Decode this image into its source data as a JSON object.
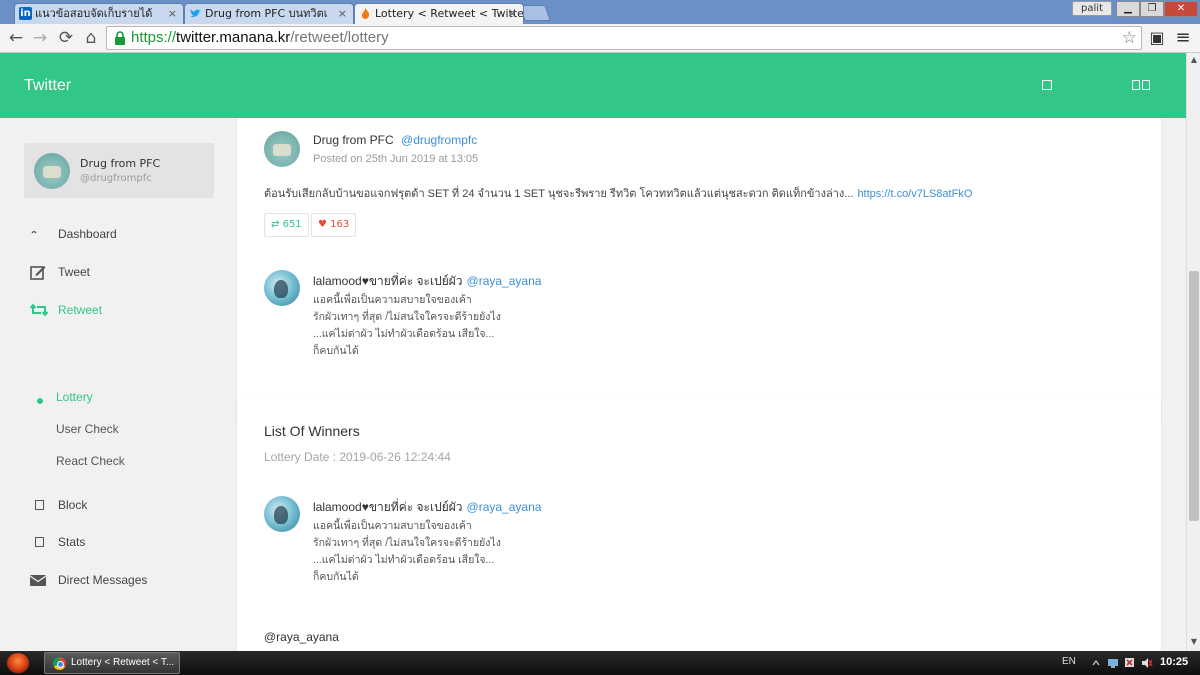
{
  "browser": {
    "tabs": [
      {
        "favicon": "linkedin-icon",
        "favicon_text": "in",
        "title": "แนวข้อสอบจัดเก็บรายได้",
        "close": "×"
      },
      {
        "favicon": "twitter-icon",
        "title": "Drug from PFC  บนทวิตเ",
        "close": "×"
      },
      {
        "favicon": "flame-icon",
        "title": "Lottery < Retweet < Twitter",
        "close": "×"
      }
    ],
    "user_badge": "palit",
    "window_controls": {
      "minimize": "▁",
      "maximize": "❐",
      "close": "✕"
    },
    "url": {
      "scheme": "https://",
      "host": "twitter.manana.kr",
      "path": "/retweet/lottery"
    },
    "nav_glyphs": {
      "back": "←",
      "forward": "→",
      "reload": "⟳",
      "home": "⌂",
      "star": "☆",
      "menu": "≡",
      "extension": "▣"
    }
  },
  "app": {
    "brand": "Twitter",
    "accent_color": "#32c787",
    "link_color": "#3b8fd9",
    "like_color": "#e74c3c"
  },
  "sidebar": {
    "profile": {
      "name": "Drug from PFC ",
      "handle": "@drugfrompfc"
    },
    "items": [
      {
        "icon": "dashboard-icon",
        "label": "Dashboard"
      },
      {
        "icon": "edit-icon",
        "label": "Tweet"
      },
      {
        "icon": "retweet-icon",
        "label": "Retweet",
        "active": true
      },
      {
        "icon": "block-icon",
        "label": "Block"
      },
      {
        "icon": "stats-icon",
        "label": "Stats"
      },
      {
        "icon": "mail-icon",
        "label": "Direct Messages"
      }
    ],
    "subitems": [
      {
        "label": "Lottery",
        "active": true
      },
      {
        "label": "User Check"
      },
      {
        "label": "React Check"
      }
    ]
  },
  "post": {
    "author_name": "Drug from PFC ",
    "author_handle": "@drugfrompfc",
    "posted": "Posted on 25th Jun 2019 at 13:05",
    "text": "ต้อนรับเสียกลับบ้านขอแจกฟรุตด้า SET ที่ 24 จำนวน 1 SET นุชจะรีพราย รีทวิต โควททวิตแล้วแต่นุชสะดวก ติดแท็กข้างล่าง...",
    "link": "https://t.co/v7LS8atFkO",
    "retweets": "651",
    "likes": "163",
    "retweet_glyph": "⇄",
    "like_glyph": "♥"
  },
  "retweeter": {
    "name": "lalamood♥ขายที่ค่ะ จะเปย์ผัว",
    "handle": "@raya_ayana",
    "bio": [
      "แอคนี้เพื่อเป็นความสบายใจของเค้า",
      "รักผัวเทาๆ ที่สุด /ไม่สนใจใครจะดีร้ายยังไง",
      "...แค่ไม่ด่าผัว ไม่ทำผัวเดือดร้อน เสียใจ...",
      "ก็คบกันได้"
    ]
  },
  "winners": {
    "title": "List Of Winners",
    "date": "Lottery Date : 2019-06-26 12:24:44",
    "winner": {
      "name": "lalamood♥ขายที่ค่ะ จะเปย์ผัว",
      "handle": "@raya_ayana",
      "bio": [
        "แอคนี้เพื่อเป็นความสบายใจของเค้า",
        "รักผัวเทาๆ ที่สุด /ไม่สนใจใครจะดีร้ายยังไง",
        "...แค่ไม่ด่าผัว ไม่ทำผัวเดือดร้อน เสียใจ...",
        "ก็คบกันได้"
      ]
    },
    "footer_handle": "@raya_ayana"
  },
  "taskbar": {
    "task_label": "Lottery < Retweet < T...",
    "lang": "EN",
    "clock": "10:25"
  }
}
